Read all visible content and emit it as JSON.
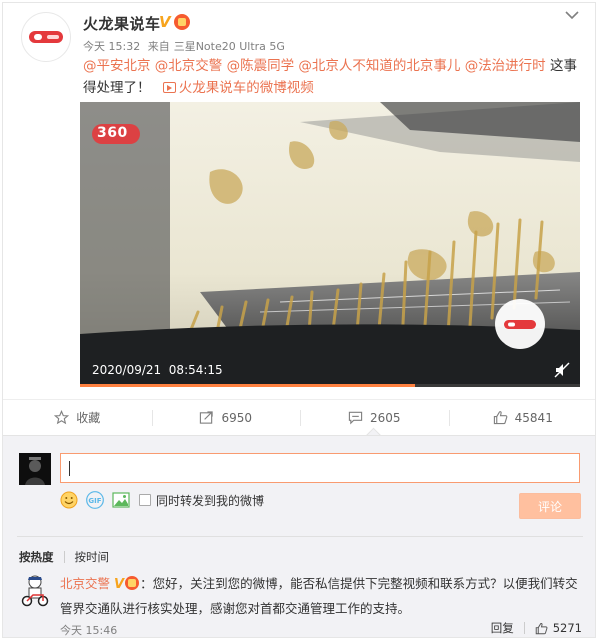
{
  "post": {
    "author": "火龙果说车",
    "verified_mark": "V",
    "time": "今天 15:32",
    "source_prefix": "来自",
    "source_device": "三星Note20 Ultra 5G",
    "mentions": [
      "@平安北京",
      "@北京交警",
      "@陈震同学",
      "@北京人不知道的北京事儿",
      "@法治进行时"
    ],
    "text_after": "这事得处理了！",
    "video_link_label": "火龙果说车的微博视频",
    "video": {
      "watermark": "360",
      "timestamp": "2020/09/21  08:54:15",
      "progress": 0.67
    }
  },
  "actions": {
    "favorite_label": "收藏",
    "repost_count": "6950",
    "comment_count": "2605",
    "like_count": "45841"
  },
  "composer": {
    "value": "",
    "forward_label": "同时转发到我的微博",
    "submit_label": "评论"
  },
  "sort": {
    "hot_label": "按热度",
    "time_label": "按时间"
  },
  "comment": {
    "user": "北京交警",
    "verified_mark": "V",
    "text": "：您好，关注到您的微博，能否私信提供下完整视频和联系方式？以便我们转交管界交通队进行核实处理，感谢您对首都交通管理工作的支持。",
    "time": "今天 15:46",
    "reply_label": "回复",
    "like_count": "5271"
  },
  "colors": {
    "accent": "#eb7350",
    "verified": "#f7a41d",
    "submit_disabled": "#ffc09f",
    "progress": "#ff8140"
  }
}
